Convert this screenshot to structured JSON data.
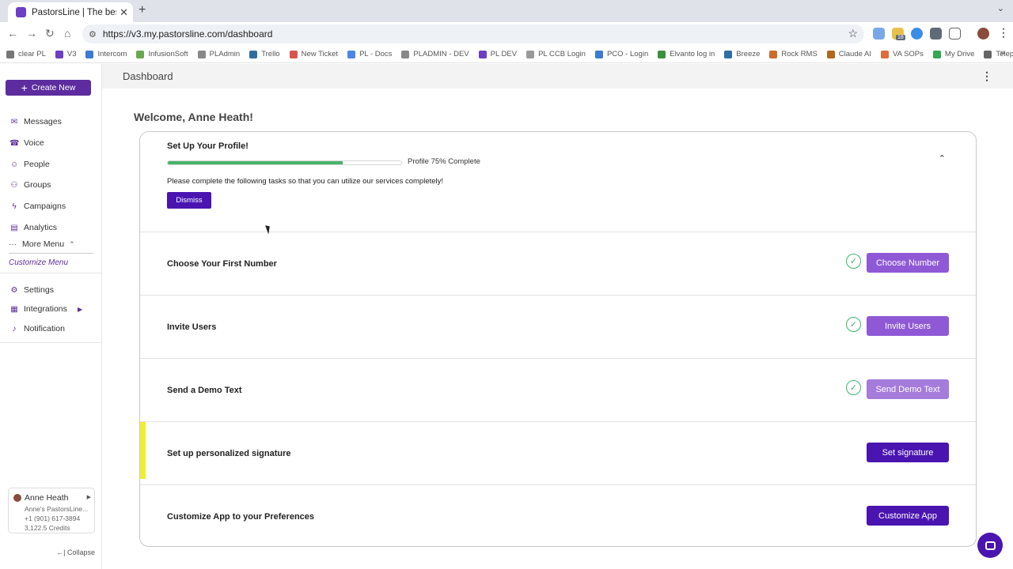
{
  "browser": {
    "tab_title": "PastorsLine | The best bulk te",
    "tab_close": "✕",
    "new_tab": "+",
    "tab_menu": "⌄",
    "url": "https://v3.my.pastorsline.com/dashboard",
    "ext_badge": "18",
    "bookmarks": [
      {
        "label": "clear PL",
        "color": "#777777"
      },
      {
        "label": "V3",
        "color": "#6c3fc4"
      },
      {
        "label": "Intercom",
        "color": "#3a7bd5"
      },
      {
        "label": "InfusionSoft",
        "color": "#6aa84f"
      },
      {
        "label": "PLAdmin",
        "color": "#888888"
      },
      {
        "label": "Trello",
        "color": "#2e6da4"
      },
      {
        "label": "New Ticket",
        "color": "#d9534f"
      },
      {
        "label": "PL - Docs",
        "color": "#4a86e8"
      },
      {
        "label": "PLADMIN - DEV",
        "color": "#888888"
      },
      {
        "label": "PL DEV",
        "color": "#6c3fc4"
      },
      {
        "label": "PL CCB Login",
        "color": "#999999"
      },
      {
        "label": "PCO - Login",
        "color": "#3a7bd5"
      },
      {
        "label": "Elvanto log in",
        "color": "#3c8f3c"
      },
      {
        "label": "Breeze",
        "color": "#2e6da4"
      },
      {
        "label": "Rock RMS",
        "color": "#d06b2b"
      },
      {
        "label": "Claude AI",
        "color": "#b5651d"
      },
      {
        "label": "VA SOPs",
        "color": "#e06c3a"
      },
      {
        "label": "My Drive",
        "color": "#34a853"
      },
      {
        "label": "Teleprompter",
        "color": "#666666"
      }
    ],
    "bookmarks_more": "»"
  },
  "sidebar": {
    "create_label": "Create New",
    "nav": [
      {
        "label": "Messages",
        "icon": "✉"
      },
      {
        "label": "Voice",
        "icon": "☎"
      },
      {
        "label": "People",
        "icon": "☺"
      },
      {
        "label": "Groups",
        "icon": "⚇"
      },
      {
        "label": "Campaigns",
        "icon": "ϟ"
      },
      {
        "label": "Analytics",
        "icon": "▤"
      }
    ],
    "more_menu": "More Menu",
    "customize_menu": "Customize Menu",
    "bottom_nav": [
      {
        "label": "Settings",
        "icon": "⚙"
      },
      {
        "label": "Integrations",
        "icon": "▦"
      },
      {
        "label": "Notification",
        "icon": "♪"
      }
    ],
    "user": {
      "name": "Anne Heath",
      "org": "Anne's PastorsLine...",
      "phone": "+1 (901) 617-3894",
      "credits": "3,122.5 Credits"
    },
    "collapse_label": "Collapse",
    "collapse_icon": "←|"
  },
  "topbar": {
    "title": "Dashboard"
  },
  "welcome": "Welcome, Anne Heath!",
  "profile": {
    "title": "Set Up Your Profile!",
    "progress": 0.75,
    "progress_label": "Profile 75% Complete",
    "description": "Please complete the following tasks so that you can utilize our services completely!",
    "dismiss_label": "Dismiss",
    "accent_color": "#4a14b1",
    "progress_color": "#48b36a"
  },
  "tasks": [
    {
      "label": "Choose Your First Number",
      "button": "Choose Number",
      "done": true
    },
    {
      "label": "Invite Users",
      "button": "Invite Users",
      "done": true
    },
    {
      "label": "Send a Demo Text",
      "button": "Send Demo Text",
      "done": true
    },
    {
      "label": "Set up personalized signature",
      "button": "Set signature",
      "done": false
    },
    {
      "label": "Customize App to your Preferences",
      "button": "Customize App",
      "done": false
    }
  ]
}
